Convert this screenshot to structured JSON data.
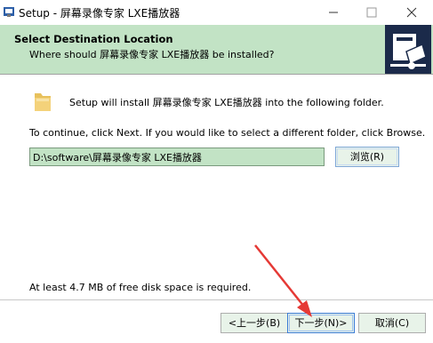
{
  "window": {
    "title": "Setup - 屏幕录像专家 LXE播放器",
    "minimize_symbol": "—",
    "maximize_symbol": "☐",
    "close_symbol": "✕"
  },
  "header": {
    "title": "Select Destination Location",
    "subtitle": "Where should 屏幕录像专家 LXE播放器 be installed?",
    "logo_icon": "setup-installer-icon"
  },
  "content": {
    "folder_icon": "folder-icon",
    "intro": "Setup will install 屏幕录像专家 LXE播放器 into the following folder.",
    "continue": "To continue, click Next. If you would like to select a different folder, click Browse.",
    "path_value": "D:\\software\\屏幕录像专家 LXE播放器",
    "browse_label": "浏览(R)",
    "disk_space": "At least 4.7 MB of free disk space is required."
  },
  "footer": {
    "back_label": "<上一步(B)",
    "next_label": "下一步(N)>",
    "cancel_label": "取消(C)"
  },
  "colors": {
    "accent_green": "#c2e3c5",
    "annotation_arrow": "#e53935"
  }
}
